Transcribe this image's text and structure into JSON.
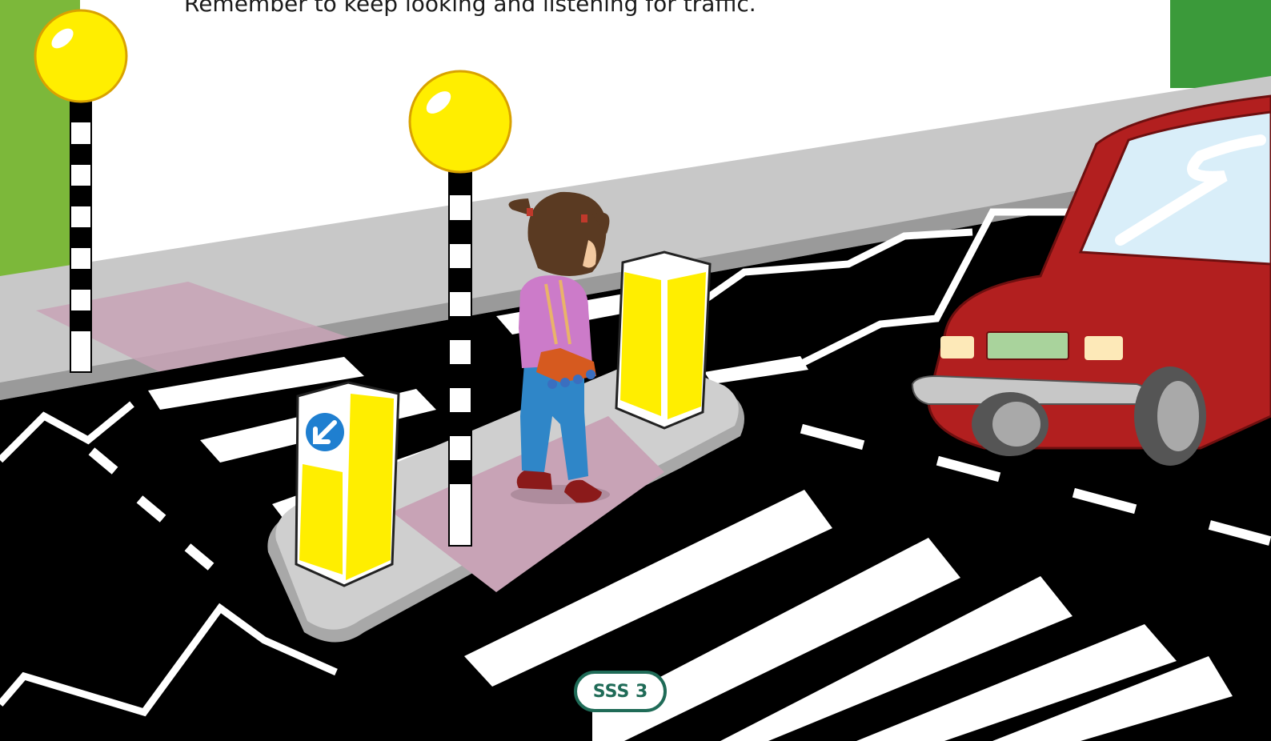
{
  "caption": "Remember to keep looking and listening for traffic.",
  "page_badge": "SSS 3",
  "colors": {
    "grass_green": "#7cb83a",
    "road_black": "#000000",
    "pavement_grey": "#c9c9c9",
    "beacon_yellow": "#ffee00",
    "car_red": "#b21f1f",
    "sign_blue": "#1f7fd0",
    "badge_green": "#1f6b57"
  },
  "icons": [
    "belisha-beacon-icon",
    "keep-left-sign-icon"
  ]
}
